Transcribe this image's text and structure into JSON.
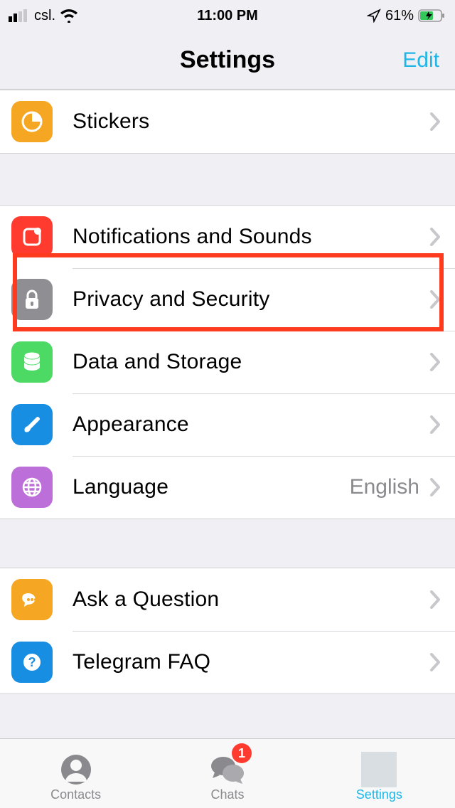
{
  "status": {
    "carrier": "csl.",
    "time": "11:00 PM",
    "battery": "61%"
  },
  "header": {
    "title": "Settings",
    "edit": "Edit"
  },
  "rows": {
    "stickers": "Stickers",
    "notifications": "Notifications and Sounds",
    "privacy": "Privacy and Security",
    "data": "Data and Storage",
    "appearance": "Appearance",
    "language": "Language",
    "language_value": "English",
    "ask": "Ask a Question",
    "faq": "Telegram FAQ"
  },
  "tabs": {
    "contacts": "Contacts",
    "chats": "Chats",
    "chats_badge": "1",
    "settings": "Settings"
  },
  "colors": {
    "accent": "#1fb6e6",
    "orange": "#f5a623",
    "red": "#ff3b30",
    "gray": "#8e8e93",
    "green": "#4cd964",
    "blue": "#188ee3",
    "purple": "#bd6fd9"
  }
}
